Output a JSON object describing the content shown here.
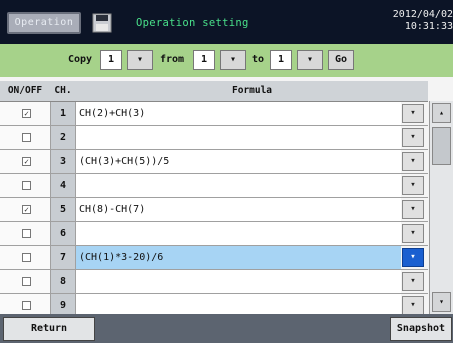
{
  "header": {
    "operation_label": "Operation",
    "title": "Operation setting",
    "date": "2012/04/02",
    "time": "10:31:33",
    "save_icon": "floppy-disk-icon"
  },
  "copy_bar": {
    "copy_label": "Copy",
    "copy_value": "1",
    "from_label": "from",
    "from_value": "1",
    "to_label": "to",
    "to_value": "1",
    "go_label": "Go",
    "dropdown_arrow": "▾"
  },
  "table": {
    "headers": {
      "onoff": "ON/OFF",
      "ch": "CH.",
      "formula": "Formula"
    },
    "rows": [
      {
        "checked": true,
        "ch": "1",
        "formula": "CH(2)+CH(3)",
        "selected": false
      },
      {
        "checked": false,
        "ch": "2",
        "formula": "",
        "selected": false
      },
      {
        "checked": true,
        "ch": "3",
        "formula": "(CH(3)+CH(5))/5",
        "selected": false
      },
      {
        "checked": false,
        "ch": "4",
        "formula": "",
        "selected": false
      },
      {
        "checked": true,
        "ch": "5",
        "formula": "CH(8)-CH(7)",
        "selected": false
      },
      {
        "checked": false,
        "ch": "6",
        "formula": "",
        "selected": false
      },
      {
        "checked": false,
        "ch": "7",
        "formula": "(CH(1)*3-20)/6",
        "selected": true
      },
      {
        "checked": false,
        "ch": "8",
        "formula": "",
        "selected": false
      },
      {
        "checked": false,
        "ch": "9",
        "formula": "",
        "selected": false
      }
    ]
  },
  "scrollbar": {
    "up": "▴",
    "down": "▾"
  },
  "footer": {
    "return_label": "Return",
    "snapshot_label": "Snapshot"
  },
  "colors": {
    "header_bg": "#0c1426",
    "title": "#49e08a",
    "copybar_bg": "#a6d28a",
    "selected_row": "#a7d4f4",
    "selected_dropdown": "#1a5fd0"
  }
}
